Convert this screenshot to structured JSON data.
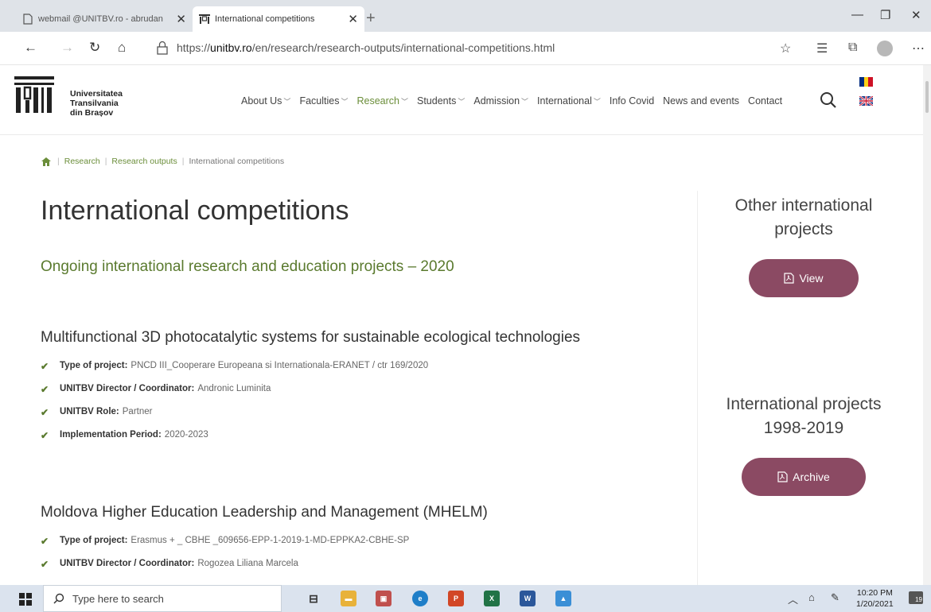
{
  "browser": {
    "tabs": [
      {
        "label": "webmail @UNITBV.ro - abrudan"
      },
      {
        "label": "International competitions"
      }
    ],
    "new_tab": "+",
    "url_prefix": "https://",
    "url_host": "unitbv.ro",
    "url_path": "/en/research/research-outputs/international-competitions.html"
  },
  "site": {
    "logo_lines": [
      "Universitatea",
      "Transilvania",
      "din Brașov"
    ],
    "menu": [
      {
        "label": "About Us",
        "has_dropdown": true
      },
      {
        "label": "Faculties",
        "has_dropdown": true
      },
      {
        "label": "Research",
        "has_dropdown": true,
        "active": true
      },
      {
        "label": "Students",
        "has_dropdown": true
      },
      {
        "label": "Admission",
        "has_dropdown": true
      },
      {
        "label": "International",
        "has_dropdown": true
      },
      {
        "label": "Info Covid",
        "has_dropdown": false
      },
      {
        "label": "News and events",
        "has_dropdown": false
      },
      {
        "label": "Contact",
        "has_dropdown": false
      }
    ],
    "accent_green": "#5a7a2e",
    "accent_button": "#8b4a63"
  },
  "breadcrumb": [
    "Research",
    "Research outputs",
    "International competitions"
  ],
  "main": {
    "title": "International competitions",
    "subtitle": "Ongoing international research and education projects – 2020",
    "projects": [
      {
        "title": "Multifunctional 3D photocatalytic systems for sustainable ecological technologies",
        "fields": [
          {
            "label": "Type of project:",
            "value": "PNCD III_Cooperare Europeana si Internationala-ERANET / ctr 169/2020"
          },
          {
            "label": "UNITBV Director / Coordinator:",
            "value": "Andronic Luminita"
          },
          {
            "label": "UNITBV Role:",
            "value": "Partner"
          },
          {
            "label": "Implementation Period:",
            "value": "2020-2023"
          }
        ]
      },
      {
        "title": "Moldova Higher Education Leadership and Management (MHELM)",
        "fields": [
          {
            "label": "Type of project:",
            "value": "Erasmus + _ CBHE _609656-EPP-1-2019-1-MD-EPPKA2-CBHE-SP"
          },
          {
            "label": "UNITBV Director / Coordinator:",
            "value": "Rogozea Liliana Marcela"
          }
        ]
      }
    ]
  },
  "sidebar": {
    "block1": {
      "title_line1": "Other international",
      "title_line2": "projects",
      "button": "View"
    },
    "block2": {
      "title_line1": "International projects",
      "title_line2": "1998-2019",
      "button": "Archive"
    }
  },
  "taskbar": {
    "search_placeholder": "Type here to search",
    "time": "10:20 PM",
    "date": "1/20/2021",
    "notifications": "19"
  }
}
